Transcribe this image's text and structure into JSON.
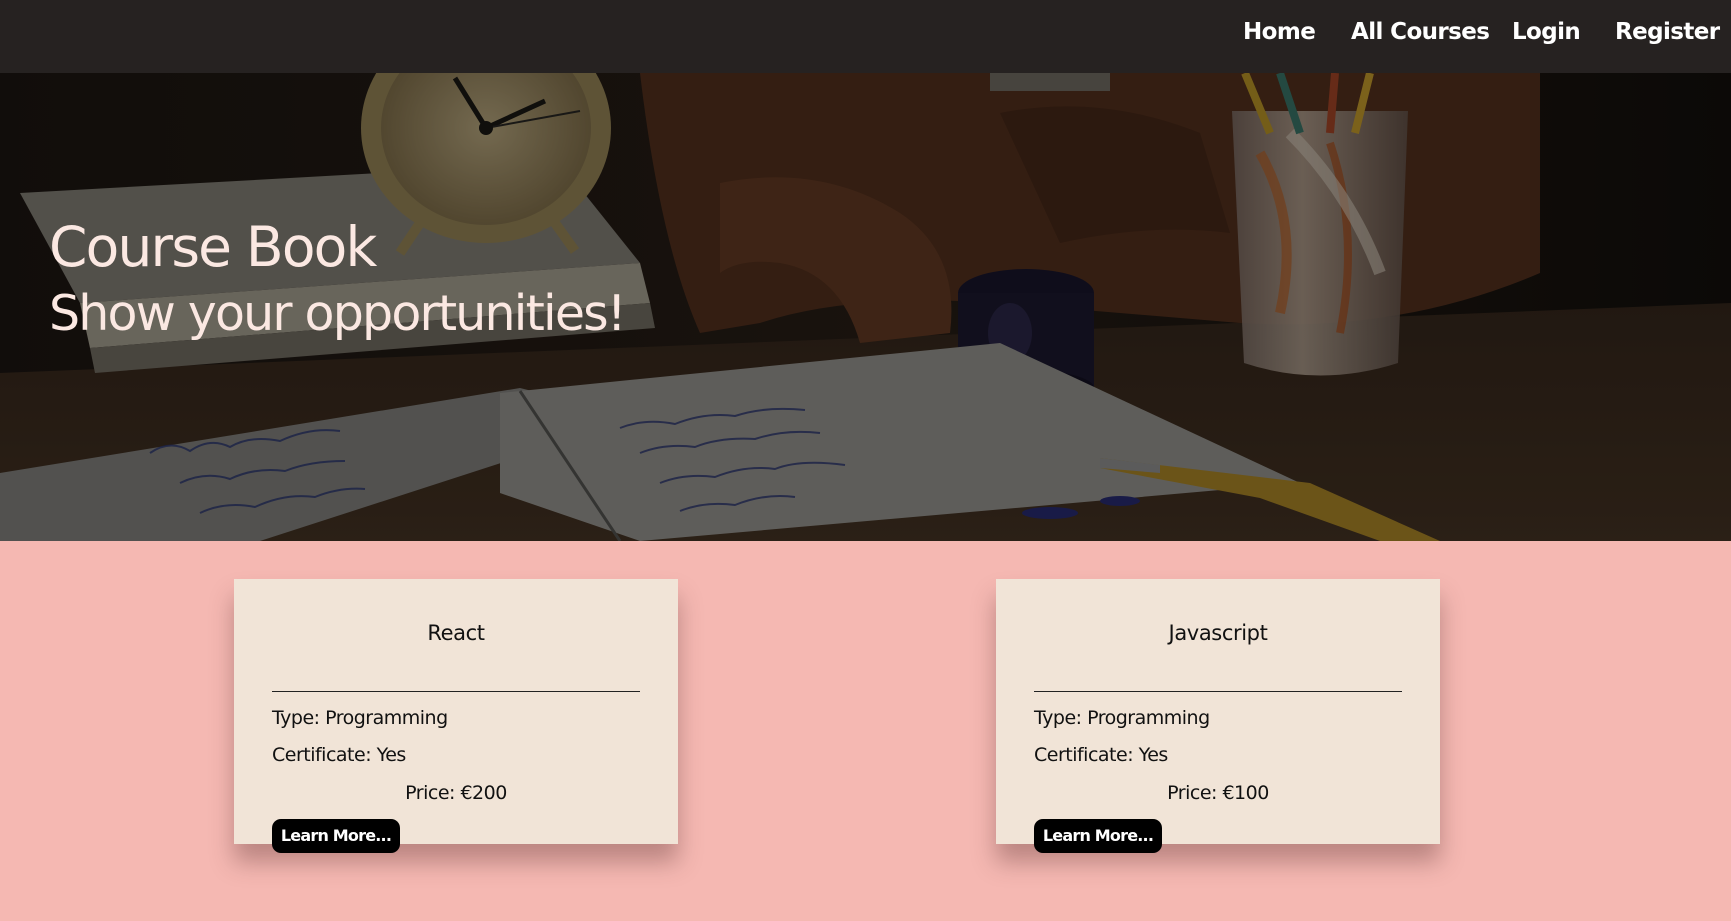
{
  "nav": {
    "items": [
      {
        "label": "Home"
      },
      {
        "label": "All Courses"
      },
      {
        "label": "Login"
      },
      {
        "label": "Register"
      }
    ]
  },
  "hero": {
    "title": "Course Book",
    "subtitle": "Show your opportunities!"
  },
  "courses": [
    {
      "name": "React",
      "type": "Type: Programming",
      "certificate": "Certificate: Yes",
      "price": "Price: €200",
      "button": "Learn More..."
    },
    {
      "name": "Javascript",
      "type": "Type: Programming",
      "certificate": "Certificate: Yes",
      "price": "Price: €100",
      "button": "Learn More..."
    }
  ],
  "colors": {
    "navbar": "#262221",
    "page_background": "#f5b8b2",
    "card_background": "#f1e4d7",
    "button": "#000000",
    "hero_text": "#fbe8e2"
  }
}
